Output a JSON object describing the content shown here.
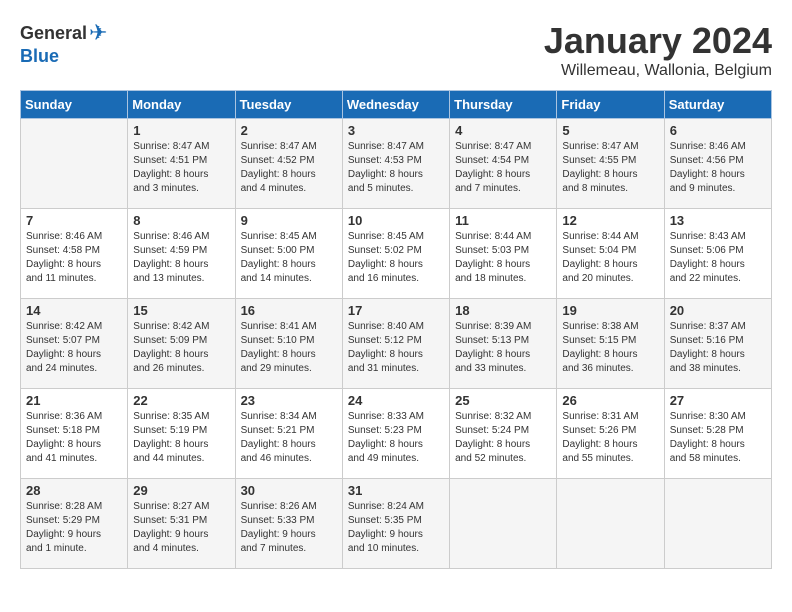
{
  "header": {
    "logo_general": "General",
    "logo_blue": "Blue",
    "month": "January 2024",
    "location": "Willemeau, Wallonia, Belgium"
  },
  "weekdays": [
    "Sunday",
    "Monday",
    "Tuesday",
    "Wednesday",
    "Thursday",
    "Friday",
    "Saturday"
  ],
  "weeks": [
    [
      {
        "day": "",
        "info": ""
      },
      {
        "day": "1",
        "info": "Sunrise: 8:47 AM\nSunset: 4:51 PM\nDaylight: 8 hours\nand 3 minutes."
      },
      {
        "day": "2",
        "info": "Sunrise: 8:47 AM\nSunset: 4:52 PM\nDaylight: 8 hours\nand 4 minutes."
      },
      {
        "day": "3",
        "info": "Sunrise: 8:47 AM\nSunset: 4:53 PM\nDaylight: 8 hours\nand 5 minutes."
      },
      {
        "day": "4",
        "info": "Sunrise: 8:47 AM\nSunset: 4:54 PM\nDaylight: 8 hours\nand 7 minutes."
      },
      {
        "day": "5",
        "info": "Sunrise: 8:47 AM\nSunset: 4:55 PM\nDaylight: 8 hours\nand 8 minutes."
      },
      {
        "day": "6",
        "info": "Sunrise: 8:46 AM\nSunset: 4:56 PM\nDaylight: 8 hours\nand 9 minutes."
      }
    ],
    [
      {
        "day": "7",
        "info": "Sunrise: 8:46 AM\nSunset: 4:58 PM\nDaylight: 8 hours\nand 11 minutes."
      },
      {
        "day": "8",
        "info": "Sunrise: 8:46 AM\nSunset: 4:59 PM\nDaylight: 8 hours\nand 13 minutes."
      },
      {
        "day": "9",
        "info": "Sunrise: 8:45 AM\nSunset: 5:00 PM\nDaylight: 8 hours\nand 14 minutes."
      },
      {
        "day": "10",
        "info": "Sunrise: 8:45 AM\nSunset: 5:02 PM\nDaylight: 8 hours\nand 16 minutes."
      },
      {
        "day": "11",
        "info": "Sunrise: 8:44 AM\nSunset: 5:03 PM\nDaylight: 8 hours\nand 18 minutes."
      },
      {
        "day": "12",
        "info": "Sunrise: 8:44 AM\nSunset: 5:04 PM\nDaylight: 8 hours\nand 20 minutes."
      },
      {
        "day": "13",
        "info": "Sunrise: 8:43 AM\nSunset: 5:06 PM\nDaylight: 8 hours\nand 22 minutes."
      }
    ],
    [
      {
        "day": "14",
        "info": "Sunrise: 8:42 AM\nSunset: 5:07 PM\nDaylight: 8 hours\nand 24 minutes."
      },
      {
        "day": "15",
        "info": "Sunrise: 8:42 AM\nSunset: 5:09 PM\nDaylight: 8 hours\nand 26 minutes."
      },
      {
        "day": "16",
        "info": "Sunrise: 8:41 AM\nSunset: 5:10 PM\nDaylight: 8 hours\nand 29 minutes."
      },
      {
        "day": "17",
        "info": "Sunrise: 8:40 AM\nSunset: 5:12 PM\nDaylight: 8 hours\nand 31 minutes."
      },
      {
        "day": "18",
        "info": "Sunrise: 8:39 AM\nSunset: 5:13 PM\nDaylight: 8 hours\nand 33 minutes."
      },
      {
        "day": "19",
        "info": "Sunrise: 8:38 AM\nSunset: 5:15 PM\nDaylight: 8 hours\nand 36 minutes."
      },
      {
        "day": "20",
        "info": "Sunrise: 8:37 AM\nSunset: 5:16 PM\nDaylight: 8 hours\nand 38 minutes."
      }
    ],
    [
      {
        "day": "21",
        "info": "Sunrise: 8:36 AM\nSunset: 5:18 PM\nDaylight: 8 hours\nand 41 minutes."
      },
      {
        "day": "22",
        "info": "Sunrise: 8:35 AM\nSunset: 5:19 PM\nDaylight: 8 hours\nand 44 minutes."
      },
      {
        "day": "23",
        "info": "Sunrise: 8:34 AM\nSunset: 5:21 PM\nDaylight: 8 hours\nand 46 minutes."
      },
      {
        "day": "24",
        "info": "Sunrise: 8:33 AM\nSunset: 5:23 PM\nDaylight: 8 hours\nand 49 minutes."
      },
      {
        "day": "25",
        "info": "Sunrise: 8:32 AM\nSunset: 5:24 PM\nDaylight: 8 hours\nand 52 minutes."
      },
      {
        "day": "26",
        "info": "Sunrise: 8:31 AM\nSunset: 5:26 PM\nDaylight: 8 hours\nand 55 minutes."
      },
      {
        "day": "27",
        "info": "Sunrise: 8:30 AM\nSunset: 5:28 PM\nDaylight: 8 hours\nand 58 minutes."
      }
    ],
    [
      {
        "day": "28",
        "info": "Sunrise: 8:28 AM\nSunset: 5:29 PM\nDaylight: 9 hours\nand 1 minute."
      },
      {
        "day": "29",
        "info": "Sunrise: 8:27 AM\nSunset: 5:31 PM\nDaylight: 9 hours\nand 4 minutes."
      },
      {
        "day": "30",
        "info": "Sunrise: 8:26 AM\nSunset: 5:33 PM\nDaylight: 9 hours\nand 7 minutes."
      },
      {
        "day": "31",
        "info": "Sunrise: 8:24 AM\nSunset: 5:35 PM\nDaylight: 9 hours\nand 10 minutes."
      },
      {
        "day": "",
        "info": ""
      },
      {
        "day": "",
        "info": ""
      },
      {
        "day": "",
        "info": ""
      }
    ]
  ]
}
